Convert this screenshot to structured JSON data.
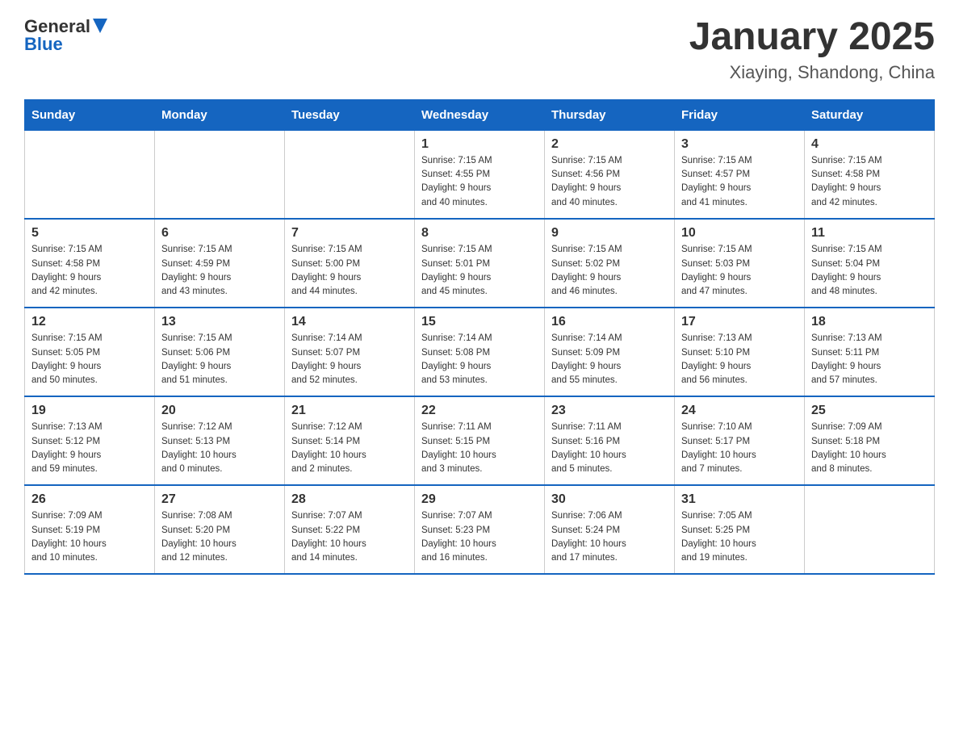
{
  "logo": {
    "text_general": "General",
    "text_blue": "Blue"
  },
  "title": "January 2025",
  "location": "Xiaying, Shandong, China",
  "weekdays": [
    "Sunday",
    "Monday",
    "Tuesday",
    "Wednesday",
    "Thursday",
    "Friday",
    "Saturday"
  ],
  "weeks": [
    [
      {
        "day": "",
        "info": ""
      },
      {
        "day": "",
        "info": ""
      },
      {
        "day": "",
        "info": ""
      },
      {
        "day": "1",
        "info": "Sunrise: 7:15 AM\nSunset: 4:55 PM\nDaylight: 9 hours\nand 40 minutes."
      },
      {
        "day": "2",
        "info": "Sunrise: 7:15 AM\nSunset: 4:56 PM\nDaylight: 9 hours\nand 40 minutes."
      },
      {
        "day": "3",
        "info": "Sunrise: 7:15 AM\nSunset: 4:57 PM\nDaylight: 9 hours\nand 41 minutes."
      },
      {
        "day": "4",
        "info": "Sunrise: 7:15 AM\nSunset: 4:58 PM\nDaylight: 9 hours\nand 42 minutes."
      }
    ],
    [
      {
        "day": "5",
        "info": "Sunrise: 7:15 AM\nSunset: 4:58 PM\nDaylight: 9 hours\nand 42 minutes."
      },
      {
        "day": "6",
        "info": "Sunrise: 7:15 AM\nSunset: 4:59 PM\nDaylight: 9 hours\nand 43 minutes."
      },
      {
        "day": "7",
        "info": "Sunrise: 7:15 AM\nSunset: 5:00 PM\nDaylight: 9 hours\nand 44 minutes."
      },
      {
        "day": "8",
        "info": "Sunrise: 7:15 AM\nSunset: 5:01 PM\nDaylight: 9 hours\nand 45 minutes."
      },
      {
        "day": "9",
        "info": "Sunrise: 7:15 AM\nSunset: 5:02 PM\nDaylight: 9 hours\nand 46 minutes."
      },
      {
        "day": "10",
        "info": "Sunrise: 7:15 AM\nSunset: 5:03 PM\nDaylight: 9 hours\nand 47 minutes."
      },
      {
        "day": "11",
        "info": "Sunrise: 7:15 AM\nSunset: 5:04 PM\nDaylight: 9 hours\nand 48 minutes."
      }
    ],
    [
      {
        "day": "12",
        "info": "Sunrise: 7:15 AM\nSunset: 5:05 PM\nDaylight: 9 hours\nand 50 minutes."
      },
      {
        "day": "13",
        "info": "Sunrise: 7:15 AM\nSunset: 5:06 PM\nDaylight: 9 hours\nand 51 minutes."
      },
      {
        "day": "14",
        "info": "Sunrise: 7:14 AM\nSunset: 5:07 PM\nDaylight: 9 hours\nand 52 minutes."
      },
      {
        "day": "15",
        "info": "Sunrise: 7:14 AM\nSunset: 5:08 PM\nDaylight: 9 hours\nand 53 minutes."
      },
      {
        "day": "16",
        "info": "Sunrise: 7:14 AM\nSunset: 5:09 PM\nDaylight: 9 hours\nand 55 minutes."
      },
      {
        "day": "17",
        "info": "Sunrise: 7:13 AM\nSunset: 5:10 PM\nDaylight: 9 hours\nand 56 minutes."
      },
      {
        "day": "18",
        "info": "Sunrise: 7:13 AM\nSunset: 5:11 PM\nDaylight: 9 hours\nand 57 minutes."
      }
    ],
    [
      {
        "day": "19",
        "info": "Sunrise: 7:13 AM\nSunset: 5:12 PM\nDaylight: 9 hours\nand 59 minutes."
      },
      {
        "day": "20",
        "info": "Sunrise: 7:12 AM\nSunset: 5:13 PM\nDaylight: 10 hours\nand 0 minutes."
      },
      {
        "day": "21",
        "info": "Sunrise: 7:12 AM\nSunset: 5:14 PM\nDaylight: 10 hours\nand 2 minutes."
      },
      {
        "day": "22",
        "info": "Sunrise: 7:11 AM\nSunset: 5:15 PM\nDaylight: 10 hours\nand 3 minutes."
      },
      {
        "day": "23",
        "info": "Sunrise: 7:11 AM\nSunset: 5:16 PM\nDaylight: 10 hours\nand 5 minutes."
      },
      {
        "day": "24",
        "info": "Sunrise: 7:10 AM\nSunset: 5:17 PM\nDaylight: 10 hours\nand 7 minutes."
      },
      {
        "day": "25",
        "info": "Sunrise: 7:09 AM\nSunset: 5:18 PM\nDaylight: 10 hours\nand 8 minutes."
      }
    ],
    [
      {
        "day": "26",
        "info": "Sunrise: 7:09 AM\nSunset: 5:19 PM\nDaylight: 10 hours\nand 10 minutes."
      },
      {
        "day": "27",
        "info": "Sunrise: 7:08 AM\nSunset: 5:20 PM\nDaylight: 10 hours\nand 12 minutes."
      },
      {
        "day": "28",
        "info": "Sunrise: 7:07 AM\nSunset: 5:22 PM\nDaylight: 10 hours\nand 14 minutes."
      },
      {
        "day": "29",
        "info": "Sunrise: 7:07 AM\nSunset: 5:23 PM\nDaylight: 10 hours\nand 16 minutes."
      },
      {
        "day": "30",
        "info": "Sunrise: 7:06 AM\nSunset: 5:24 PM\nDaylight: 10 hours\nand 17 minutes."
      },
      {
        "day": "31",
        "info": "Sunrise: 7:05 AM\nSunset: 5:25 PM\nDaylight: 10 hours\nand 19 minutes."
      },
      {
        "day": "",
        "info": ""
      }
    ]
  ]
}
